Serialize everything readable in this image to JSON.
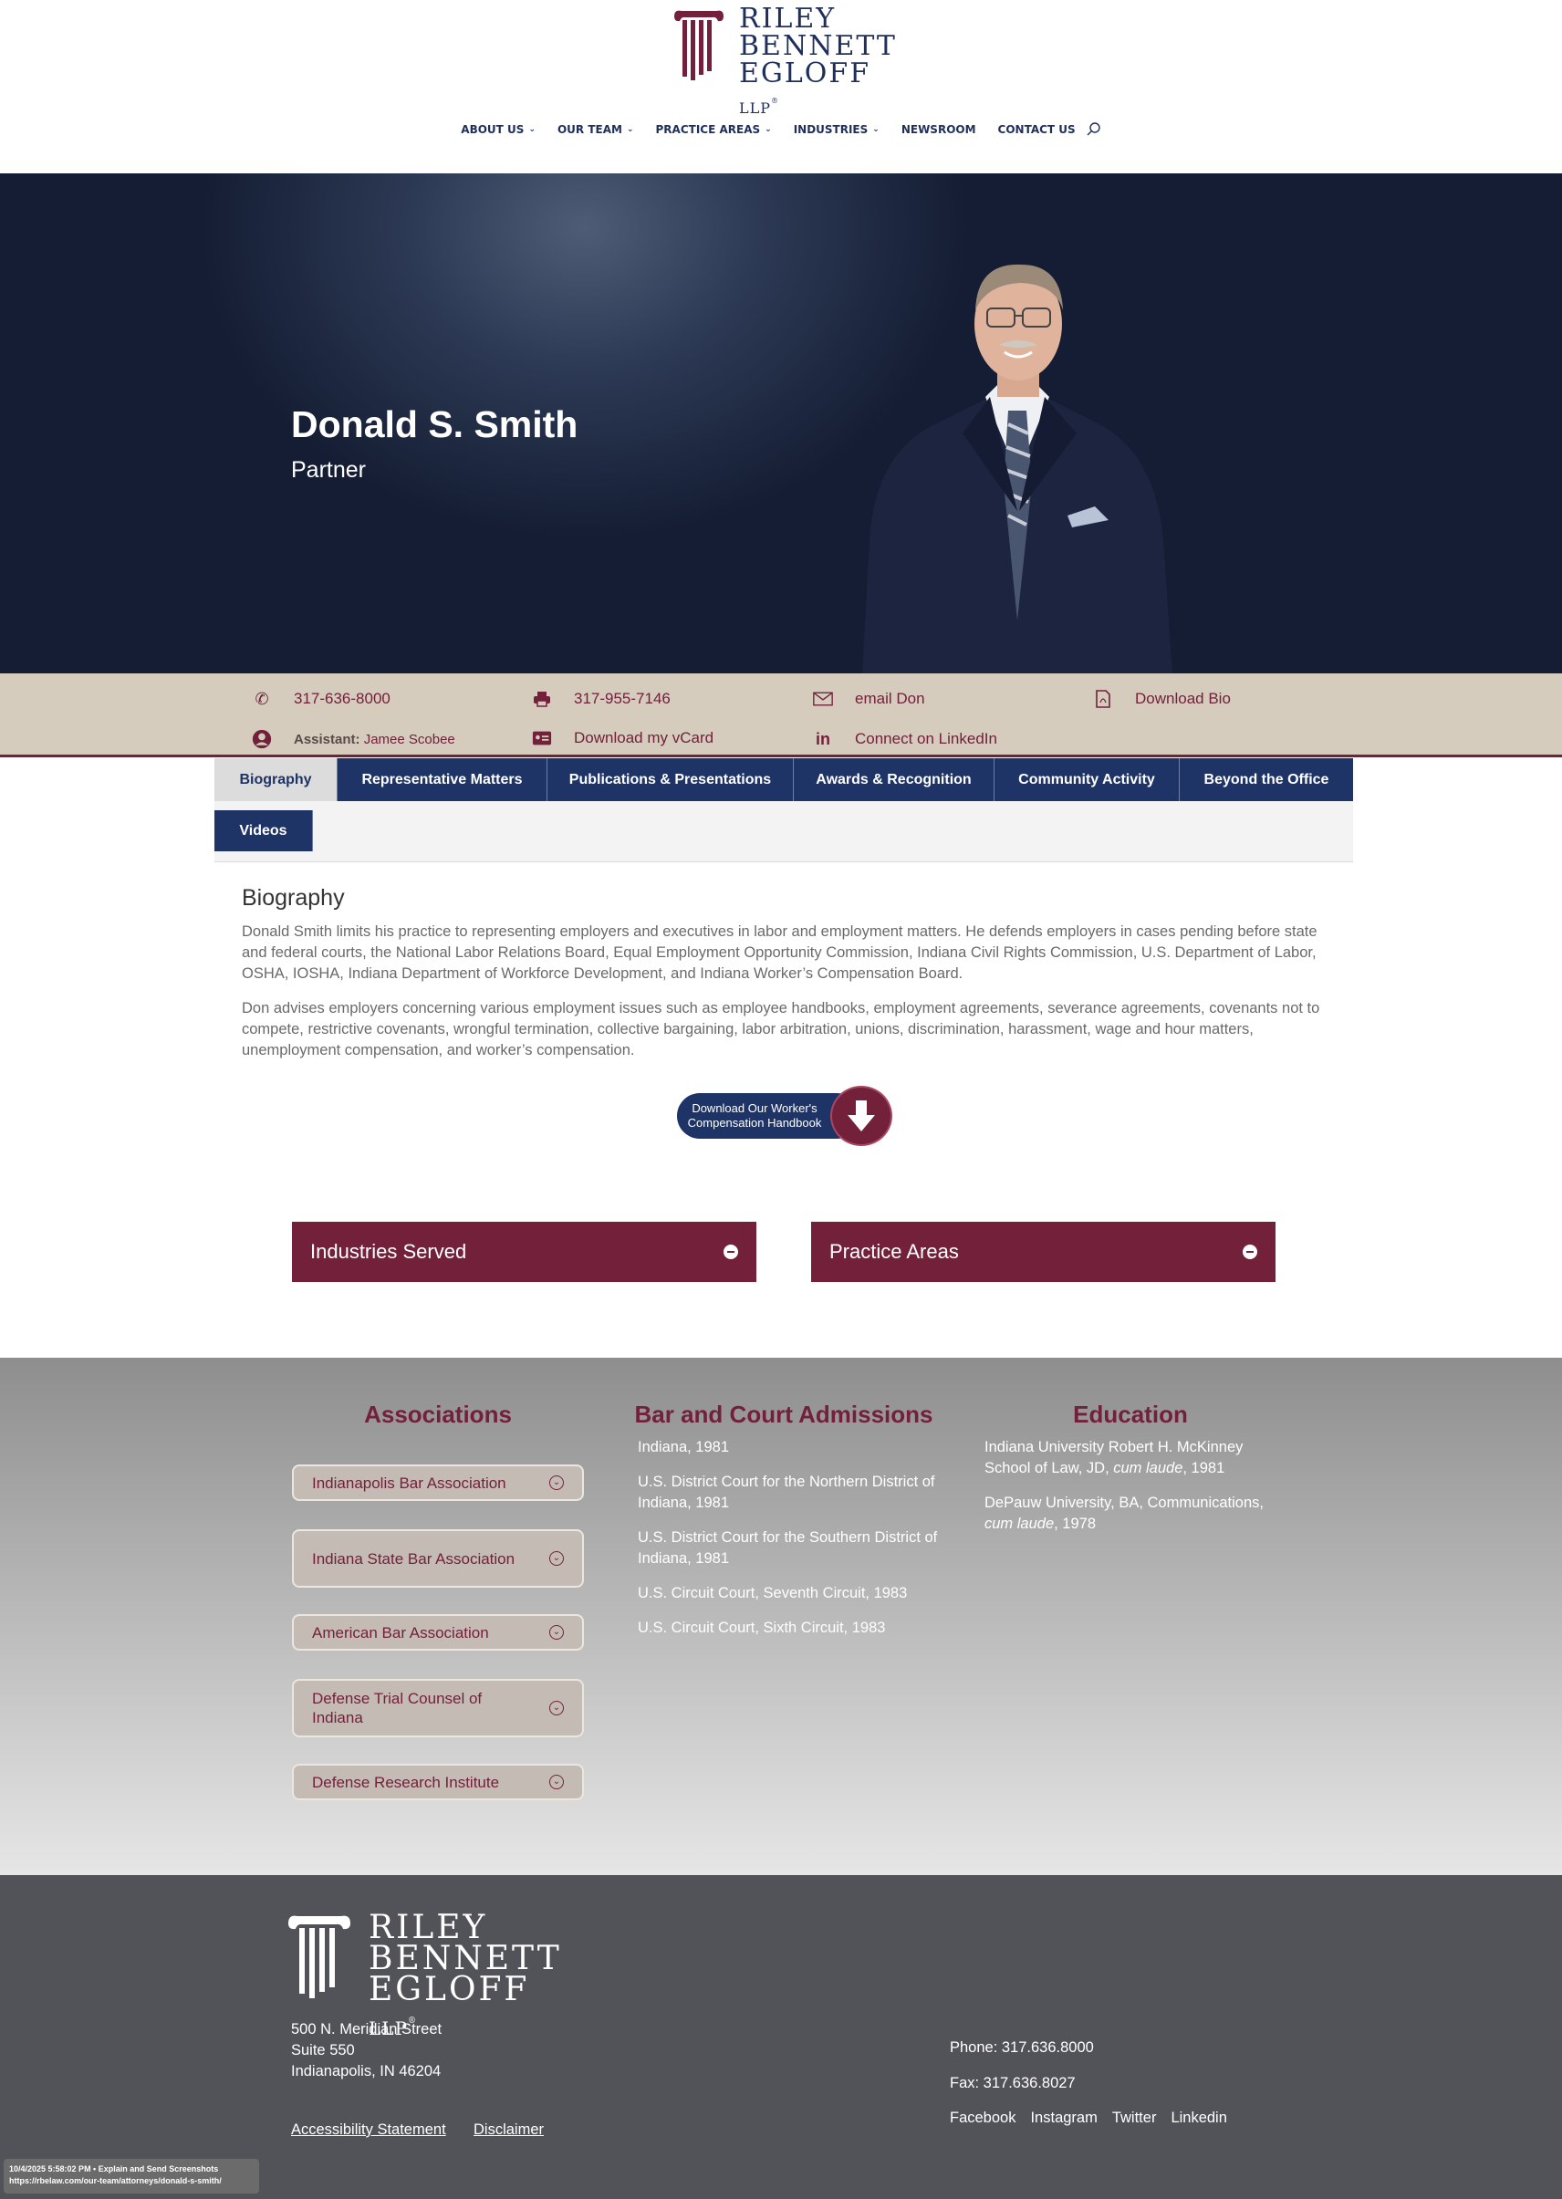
{
  "logo": {
    "line1": "RILEY",
    "line2": "BENNETT",
    "line3": "EGLOFF",
    "suffix": "LLP",
    "reg": "®"
  },
  "nav": {
    "items": [
      {
        "label": "ABOUT US",
        "has_dropdown": true
      },
      {
        "label": "OUR TEAM",
        "has_dropdown": true
      },
      {
        "label": "PRACTICE AREAS",
        "has_dropdown": true
      },
      {
        "label": "INDUSTRIES",
        "has_dropdown": true
      },
      {
        "label": "NEWSROOM",
        "has_dropdown": false
      },
      {
        "label": "CONTACT US",
        "has_dropdown": false
      }
    ],
    "search_icon": "search-icon"
  },
  "hero": {
    "name": "Donald S. Smith",
    "title": "Partner"
  },
  "contact": {
    "phone": "317-636-8000",
    "fax": "317-955-7146",
    "email": "email Don",
    "bio": "Download Bio",
    "assistant_label": "Assistant:",
    "assistant_name": "Jamee Scobee",
    "vcard": "Download my vCard",
    "linkedin": "Connect on LinkedIn"
  },
  "tabs": [
    {
      "label": "Biography",
      "active": true
    },
    {
      "label": "Representative Matters",
      "active": false
    },
    {
      "label": "Publications & Presentations",
      "active": false
    },
    {
      "label": "Awards & Recognition",
      "active": false
    },
    {
      "label": "Community Activity",
      "active": false
    },
    {
      "label": "Beyond the Office",
      "active": false
    },
    {
      "label": "Videos",
      "active": false
    }
  ],
  "biography": {
    "heading": "Biography",
    "p1": "Donald Smith limits his practice to representing employers and executives in labor and employment matters. He defends employers in cases pending before state and federal courts, the National Labor Relations Board, Equal Employment Opportunity Commission, Indiana Civil Rights Commission, U.S. Department of Labor, OSHA, IOSHA, Indiana Department of Workforce Development, and Indiana Worker’s Compensation Board.",
    "p2": "Don advises employers concerning various employment issues such as employee handbooks, employment agreements, severance agreements, covenants not to compete, restrictive covenants, wrongful termination, collective bargaining, labor arbitration, unions, discrimination, harassment, wage and hour matters, unemployment compensation, and worker’s compensation."
  },
  "handbook": {
    "line1": "Download Our Worker's",
    "line2": "Compensation Handbook"
  },
  "accordions": {
    "industries": "Industries Served",
    "practice": "Practice Areas"
  },
  "associations": {
    "heading": "Associations",
    "items": [
      "Indianapolis Bar Association",
      "Indiana State Bar Association",
      "American Bar Association",
      "Defense Trial Counsel of Indiana",
      "Defense Research Institute"
    ]
  },
  "admissions": {
    "heading": "Bar and Court Admissions",
    "items": [
      "Indiana, 1981",
      "U.S. District Court for the Northern District of Indiana, 1981",
      "U.S. District Court for the Southern District of Indiana, 1981",
      "U.S. Circuit Court, Seventh Circuit, 1983",
      "U.S. Circuit Court, Sixth Circuit, 1983"
    ]
  },
  "education": {
    "heading": "Education",
    "e1_a": "Indiana University Robert H. McKinney School of Law, JD, ",
    "e1_i": "cum laude",
    "e1_b": ", 1981",
    "e2_a": "DePauw University, BA, Communications, ",
    "e2_i": "cum laude",
    "e2_b": ", 1978"
  },
  "footer": {
    "addr1": "500 N. Meridian Street",
    "addr2": "Suite 550",
    "addr3": "Indianapolis, IN 46204",
    "accessibility": " Accessibility Statement",
    "disclaimer": "Disclaimer ",
    "phone": "Phone: 317.636.8000",
    "fax": "Fax: 317.636.8027",
    "social": [
      "Facebook",
      "Instagram",
      "Twitter",
      "Linkedin"
    ]
  },
  "stamp": {
    "line1": "10/4/2025 5:58:02 PM • Explain and Send Screenshots",
    "line2": "https://rbelaw.com/our-team/attorneys/donald-s-smith/"
  },
  "colors": {
    "maroon": "#73203b",
    "navy": "#1e3366",
    "tan": "#d5ccbe",
    "footer": "#525358"
  }
}
